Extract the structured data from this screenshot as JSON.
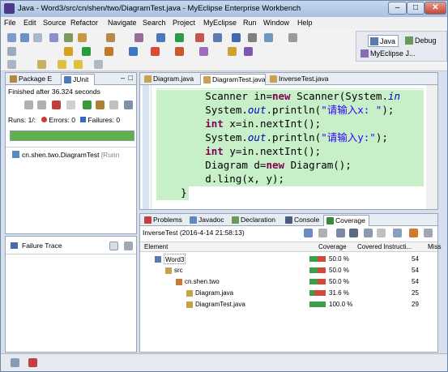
{
  "window": {
    "title": "Java - Word3/src/cn/shen/two/DiagramTest.java - MyEclipse Enterprise Workbench"
  },
  "menu": [
    "File",
    "Edit",
    "Source",
    "Refactor",
    "Navigate",
    "Search",
    "Project",
    "MyEclipse",
    "Run",
    "Window",
    "Help"
  ],
  "perspectives": {
    "java": "Java",
    "debug": "Debug",
    "myeclipse": "MyEclipse J..."
  },
  "left_tabs": {
    "package": "Package E",
    "junit": "JUnit"
  },
  "junit": {
    "finished": "Finished after 36.324 seconds",
    "runs_label": "Runs:",
    "runs_value": "1/:",
    "errors_label": "Errors:",
    "errors_value": "0",
    "failures_label": "Failures:",
    "failures_value": "0",
    "progress_color": "#5fb04b",
    "test_item": "cn.shen.two.DiagramTest",
    "test_item_suffix": "[Runn"
  },
  "failure_trace": {
    "label": "Failure Trace"
  },
  "editor_tabs": [
    "Diagram.java",
    "DiagramTest.java",
    "InverseTest.java"
  ],
  "code_lines": [
    {
      "parts": [
        [
          "",
          "        Scanner in="
        ],
        [
          "kw",
          "new"
        ],
        [
          "",
          " Scanner(System."
        ],
        [
          "it",
          "in"
        ]
      ]
    },
    {
      "parts": [
        [
          "",
          "        System."
        ],
        [
          "it",
          "out"
        ],
        [
          "",
          ".println("
        ],
        [
          "str",
          "\"请输入x: \""
        ],
        [
          "",
          ");"
        ]
      ]
    },
    {
      "parts": [
        [
          "kw",
          "        int"
        ],
        [
          "",
          " x=in.nextInt();"
        ]
      ]
    },
    {
      "parts": [
        [
          "",
          "        System."
        ],
        [
          "it",
          "out"
        ],
        [
          "",
          ".println("
        ],
        [
          "str",
          "\"请输入y:\""
        ],
        [
          "",
          ");"
        ]
      ]
    },
    {
      "parts": [
        [
          "kw",
          "        int"
        ],
        [
          "",
          " y=in.nextInt();"
        ]
      ]
    },
    {
      "parts": [
        [
          "",
          "        Diagram d="
        ],
        [
          "kw",
          "new"
        ],
        [
          "",
          " Diagram();"
        ]
      ]
    },
    {
      "parts": [
        [
          "",
          "        d.ling(x, y);"
        ]
      ]
    },
    {
      "parts": [
        [
          "",
          "    }"
        ]
      ]
    }
  ],
  "bottom_tabs": [
    "Problems",
    "Javadoc",
    "Declaration",
    "Console",
    "Coverage"
  ],
  "coverage": {
    "session": "InverseTest (2016-4-14 21:58:13)",
    "columns": [
      "Element",
      "Coverage",
      "Covered Instructi...",
      "Miss"
    ],
    "rows": [
      {
        "name": "Word3",
        "coverage": "50.0 %",
        "covered": "54",
        "pct": 50.0,
        "indent": 0
      },
      {
        "name": "src",
        "coverage": "50.0 %",
        "covered": "54",
        "pct": 50.0,
        "indent": 1
      },
      {
        "name": "cn.shen.two",
        "coverage": "50.0 %",
        "covered": "54",
        "pct": 50.0,
        "indent": 2
      },
      {
        "name": "Diagram.java",
        "coverage": "31.6 %",
        "covered": "25",
        "pct": 31.6,
        "indent": 3
      },
      {
        "name": "DiagramTest.java",
        "coverage": "100.0 %",
        "covered": "29",
        "pct": 100.0,
        "indent": 3
      }
    ]
  }
}
